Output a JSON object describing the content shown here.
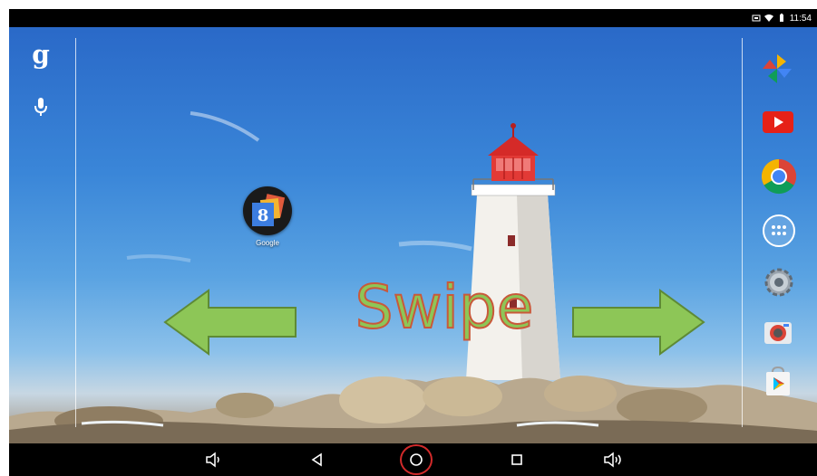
{
  "status_bar": {
    "time": "11:54",
    "icons": [
      "screenshot-icon",
      "wifi-icon",
      "battery-icon"
    ]
  },
  "sidebar_left": {
    "google_label": "g",
    "voice_icon": "mic-icon"
  },
  "home": {
    "folder_label": "Google"
  },
  "dock": {
    "icons": [
      "pinwheel-icon",
      "youtube-icon",
      "chrome-icon",
      "app-drawer-icon",
      "settings-icon",
      "camera-icon",
      "play-store-icon"
    ]
  },
  "overlay": {
    "swipe_text": "Swipe",
    "colors": {
      "text": "#8dc657",
      "outline": "#c9593a",
      "arrows": "#8dc657"
    }
  },
  "nav_bar": {
    "buttons": [
      "volume-down-icon",
      "back-icon",
      "home-icon",
      "recents-icon",
      "volume-up-icon"
    ],
    "highlighted": "home-icon",
    "highlight_color": "#d12a2a"
  }
}
